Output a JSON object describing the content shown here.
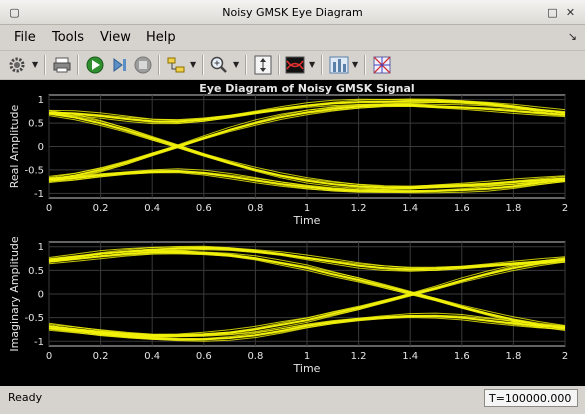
{
  "window": {
    "title": "Noisy GMSK Eye Diagram"
  },
  "menu": {
    "file": "File",
    "tools": "Tools",
    "view": "View",
    "help": "Help"
  },
  "toolbar": {
    "items": [
      "settings-icon",
      "print-icon",
      "run-icon",
      "step-forward-icon",
      "stop-icon",
      "highlight-blocks-icon",
      "zoom-icon",
      "autoscale-icon",
      "eye-display-icon",
      "scope-display-icon",
      "legend-icon"
    ]
  },
  "status": {
    "left": "Ready",
    "right": "T=100000.000"
  },
  "colors": {
    "trace": "#f2f20a",
    "axes_bg": "#000000",
    "axis": "#c8c8c8"
  },
  "chart_data": [
    {
      "type": "line",
      "title": "Eye Diagram of Noisy GMSK Signal",
      "xlabel": "Time",
      "ylabel": "Real Amplitude",
      "xlim": [
        0,
        2
      ],
      "ylim": [
        -1.1,
        1.1
      ],
      "xticks": [
        "0",
        "0.2",
        "0.4",
        "0.6",
        "0.8",
        "1",
        "1.2",
        "1.4",
        "1.6",
        "1.8",
        "2"
      ],
      "yticks": [
        "1",
        "0.5",
        "0",
        "-0.5",
        "-1"
      ],
      "grid": true,
      "series": [
        {
          "x": [
            0,
            0.1,
            0.2,
            0.3,
            0.4,
            0.5,
            0.6,
            0.7,
            0.8,
            0.9,
            1,
            1.1,
            1.2,
            1.3,
            1.4,
            1.5,
            1.6,
            1.7,
            1.8,
            1.9,
            2
          ],
          "y": [
            0.72,
            0.7,
            0.65,
            0.59,
            0.54,
            0.53,
            0.57,
            0.64,
            0.72,
            0.8,
            0.87,
            0.92,
            0.95,
            0.96,
            0.97,
            0.97,
            0.95,
            0.91,
            0.85,
            0.78,
            0.72
          ]
        },
        {
          "x": [
            0,
            0.1,
            0.2,
            0.3,
            0.4,
            0.5,
            0.6,
            0.7,
            0.8,
            0.9,
            1,
            1.1,
            1.2,
            1.3,
            1.4,
            1.5,
            1.6,
            1.7,
            1.8,
            1.9,
            2
          ],
          "y": [
            0.7,
            0.62,
            0.5,
            0.35,
            0.17,
            0.0,
            -0.18,
            -0.35,
            -0.5,
            -0.63,
            -0.73,
            -0.8,
            -0.85,
            -0.88,
            -0.88,
            -0.85,
            -0.83,
            -0.8,
            -0.76,
            -0.72,
            -0.68
          ]
        },
        {
          "x": [
            0,
            0.1,
            0.2,
            0.3,
            0.4,
            0.5,
            0.6,
            0.7,
            0.8,
            0.9,
            1,
            1.1,
            1.2,
            1.3,
            1.4,
            1.5,
            1.6,
            1.7,
            1.8,
            1.9,
            2
          ],
          "y": [
            -0.7,
            -0.62,
            -0.5,
            -0.35,
            -0.17,
            0.0,
            0.18,
            0.35,
            0.5,
            0.63,
            0.73,
            0.8,
            0.85,
            0.88,
            0.88,
            0.85,
            0.83,
            0.8,
            0.76,
            0.72,
            0.68
          ]
        },
        {
          "x": [
            0,
            0.1,
            0.2,
            0.3,
            0.4,
            0.5,
            0.6,
            0.7,
            0.8,
            0.9,
            1,
            1.1,
            1.2,
            1.3,
            1.4,
            1.5,
            1.6,
            1.7,
            1.8,
            1.9,
            2
          ],
          "y": [
            -0.72,
            -0.68,
            -0.62,
            -0.57,
            -0.54,
            -0.53,
            -0.57,
            -0.64,
            -0.72,
            -0.8,
            -0.87,
            -0.92,
            -0.95,
            -0.96,
            -0.96,
            -0.95,
            -0.93,
            -0.9,
            -0.85,
            -0.78,
            -0.72
          ]
        }
      ]
    },
    {
      "type": "line",
      "title": "",
      "xlabel": "Time",
      "ylabel": "Imaginary Amplitude",
      "xlim": [
        0,
        2
      ],
      "ylim": [
        -1.1,
        1.1
      ],
      "xticks": [
        "0",
        "0.2",
        "0.4",
        "0.6",
        "0.8",
        "1",
        "1.2",
        "1.4",
        "1.6",
        "1.8",
        "2"
      ],
      "yticks": [
        "1",
        "0.5",
        "0",
        "-0.5",
        "-1"
      ],
      "grid": true,
      "series": [
        {
          "x": [
            0,
            0.1,
            0.2,
            0.3,
            0.4,
            0.5,
            0.6,
            0.7,
            0.8,
            0.9,
            1,
            1.1,
            1.2,
            1.3,
            1.4,
            1.5,
            1.6,
            1.7,
            1.8,
            1.9,
            2
          ],
          "y": [
            0.72,
            0.78,
            0.85,
            0.9,
            0.94,
            0.96,
            0.97,
            0.95,
            0.9,
            0.84,
            0.76,
            0.68,
            0.6,
            0.55,
            0.52,
            0.53,
            0.56,
            0.6,
            0.64,
            0.68,
            0.72
          ]
        },
        {
          "x": [
            0,
            0.1,
            0.2,
            0.3,
            0.4,
            0.5,
            0.6,
            0.7,
            0.8,
            0.9,
            1,
            1.1,
            1.2,
            1.3,
            1.4,
            1.5,
            1.6,
            1.7,
            1.8,
            1.9,
            2
          ],
          "y": [
            0.68,
            0.74,
            0.8,
            0.85,
            0.88,
            0.88,
            0.86,
            0.82,
            0.75,
            0.65,
            0.55,
            0.42,
            0.3,
            0.16,
            0.02,
            -0.12,
            -0.28,
            -0.42,
            -0.55,
            -0.65,
            -0.72
          ]
        },
        {
          "x": [
            0,
            0.1,
            0.2,
            0.3,
            0.4,
            0.5,
            0.6,
            0.7,
            0.8,
            0.9,
            1,
            1.1,
            1.2,
            1.3,
            1.4,
            1.5,
            1.6,
            1.7,
            1.8,
            1.9,
            2
          ],
          "y": [
            -0.68,
            -0.74,
            -0.8,
            -0.85,
            -0.88,
            -0.88,
            -0.86,
            -0.82,
            -0.75,
            -0.65,
            -0.55,
            -0.42,
            -0.3,
            -0.16,
            -0.02,
            0.12,
            0.28,
            0.42,
            0.55,
            0.65,
            0.72
          ]
        },
        {
          "x": [
            0,
            0.1,
            0.2,
            0.3,
            0.4,
            0.5,
            0.6,
            0.7,
            0.8,
            0.9,
            1,
            1.1,
            1.2,
            1.3,
            1.4,
            1.5,
            1.6,
            1.7,
            1.8,
            1.9,
            2
          ],
          "y": [
            -0.72,
            -0.78,
            -0.85,
            -0.9,
            -0.94,
            -0.96,
            -0.96,
            -0.93,
            -0.87,
            -0.78,
            -0.68,
            -0.6,
            -0.54,
            -0.5,
            -0.47,
            -0.47,
            -0.5,
            -0.56,
            -0.62,
            -0.68,
            -0.72
          ]
        }
      ]
    }
  ]
}
